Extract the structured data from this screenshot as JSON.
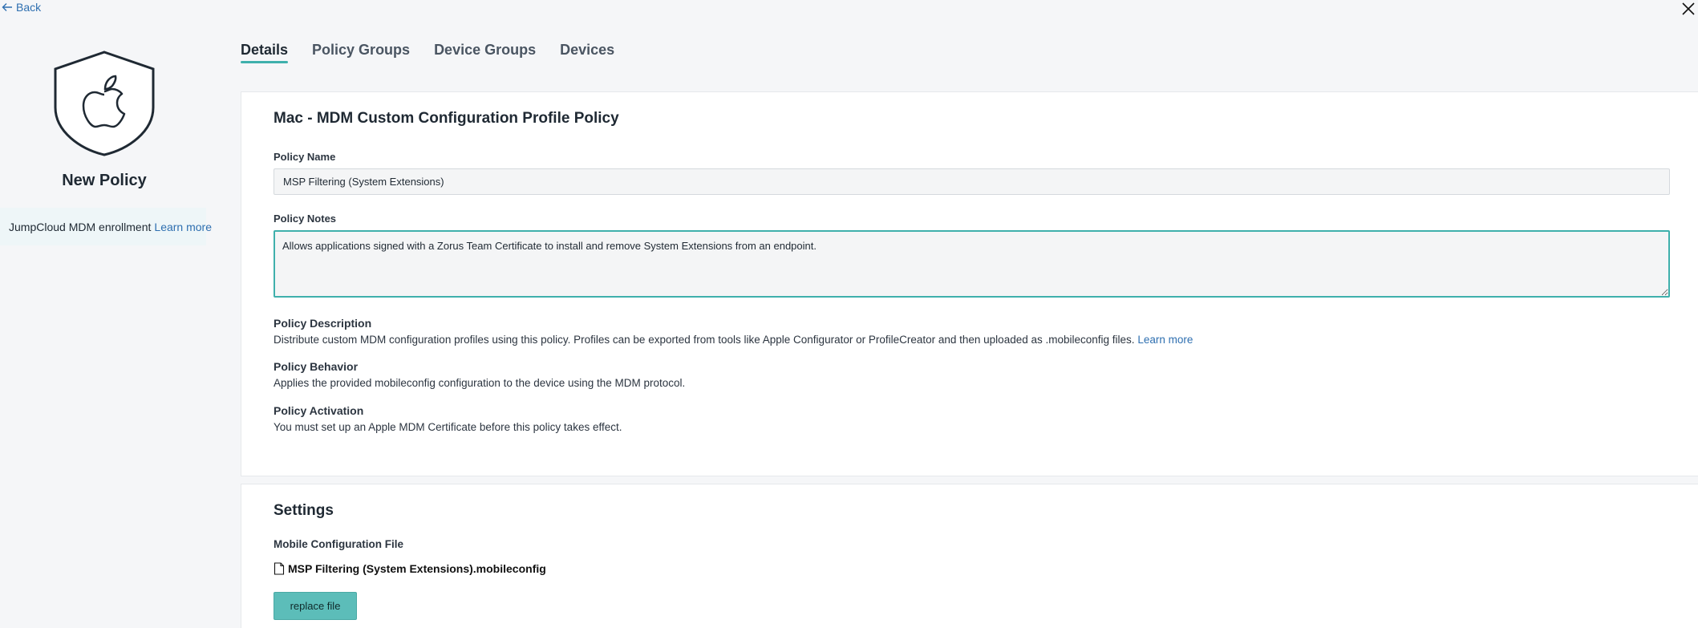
{
  "nav": {
    "back_label": "Back"
  },
  "left_panel": {
    "title": "New Policy",
    "enrollment_text": "JumpCloud MDM enrollment",
    "enrollment_link": "Learn more"
  },
  "tabs": [
    {
      "label": "Details",
      "active": true
    },
    {
      "label": "Policy Groups",
      "active": false
    },
    {
      "label": "Device Groups",
      "active": false
    },
    {
      "label": "Devices",
      "active": false
    }
  ],
  "details": {
    "title": "Mac - MDM Custom Configuration Profile Policy",
    "policy_name_label": "Policy Name",
    "policy_name_value": "MSP Filtering (System Extensions)",
    "policy_notes_label": "Policy Notes",
    "policy_notes_value": "Allows applications signed with a Zorus Team Certificate to install and remove System Extensions from an endpoint.",
    "description_label": "Policy Description",
    "description_text": "Distribute custom MDM configuration profiles using this policy. Profiles can be exported from tools like Apple Configurator or ProfileCreator and then uploaded as .mobileconfig files.",
    "description_link": "Learn more",
    "behavior_label": "Policy Behavior",
    "behavior_text": "Applies the provided mobileconfig configuration to the device using the MDM protocol.",
    "activation_label": "Policy Activation",
    "activation_text": "You must set up an Apple MDM Certificate before this policy takes effect."
  },
  "settings": {
    "title": "Settings",
    "file_label": "Mobile Configuration File",
    "file_name": "MSP Filtering (System Extensions).mobileconfig",
    "replace_button": "replace file"
  },
  "colors": {
    "accent": "#3fb0ac",
    "button": "#5cbdb9",
    "link": "#2e6fb0"
  }
}
